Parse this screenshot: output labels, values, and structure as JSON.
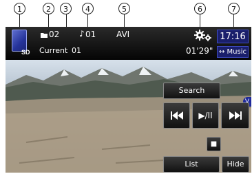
{
  "callouts": [
    "1",
    "2",
    "3",
    "4",
    "5",
    "6",
    "7"
  ],
  "status_bar": {
    "media_label": "SD",
    "folder_number": "02",
    "current_label": "Current",
    "current_value": "01",
    "track_number": "01",
    "file_type": "AVI",
    "elapsed_time": "01'29\"",
    "clock": "17:16",
    "source_button": "↔ Music"
  },
  "controls": {
    "search_label": "Search",
    "prev_label": "⏮",
    "play_pause_label": "▶/II",
    "next_label": "⏭",
    "stop_label": "■",
    "list_label": "List",
    "hide_label": "Hide"
  },
  "side_badge": "V"
}
